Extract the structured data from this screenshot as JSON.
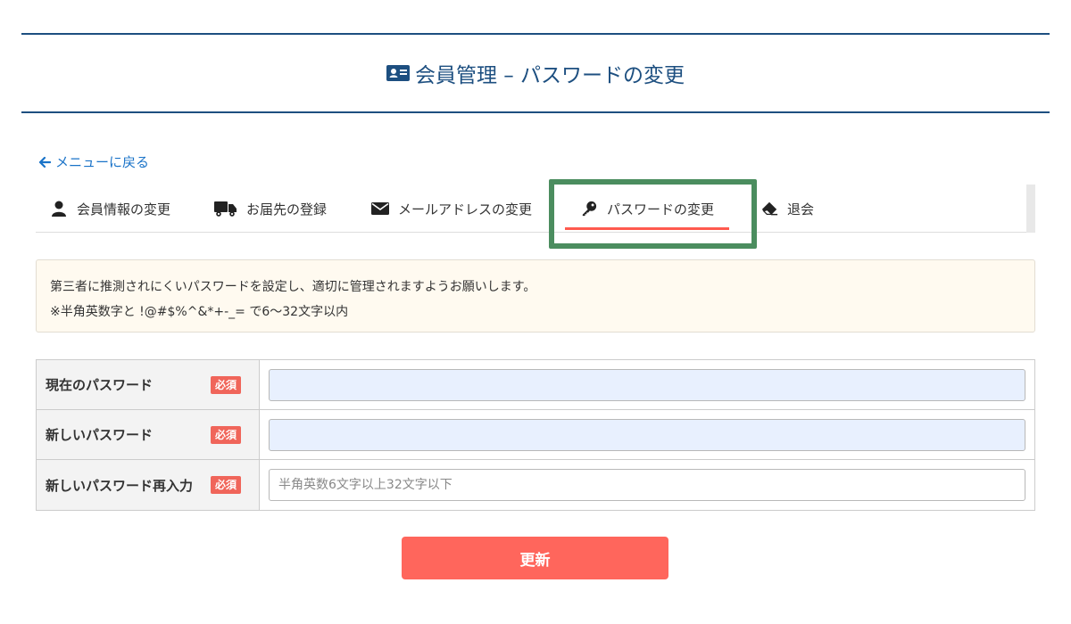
{
  "header": {
    "title": "会員管理 – パスワードの変更",
    "icon": "id-card-icon",
    "color": "#1d4f80"
  },
  "back_link": {
    "label": "メニューに戻る",
    "icon": "arrow-left-icon"
  },
  "tabs": [
    {
      "label": "会員情報の変更",
      "icon": "user-icon"
    },
    {
      "label": "お届先の登録",
      "icon": "truck-icon"
    },
    {
      "label": "メールアドレスの変更",
      "icon": "envelope-icon"
    },
    {
      "label": "パスワードの変更",
      "icon": "key-icon",
      "active": true
    },
    {
      "label": "退会",
      "icon": "eraser-icon"
    }
  ],
  "notice": {
    "line1": "第三者に推測されにくいパスワードを設定し、適切に管理されますようお願いします。",
    "line2": "※半角英数字と !@#$%^&*+-_= で6～32文字以内"
  },
  "form": {
    "required_label": "必須",
    "fields": [
      {
        "label": "現在のパスワード",
        "value": "",
        "placeholder": ""
      },
      {
        "label": "新しいパスワード",
        "value": "",
        "placeholder": ""
      },
      {
        "label": "新しいパスワード再入力",
        "value": "",
        "placeholder": "半角英数6文字以上32文字以下"
      }
    ]
  },
  "submit": {
    "label": "更新",
    "color": "#ff665c"
  },
  "colors": {
    "accent": "#ff5a4e",
    "highlight": "#4b8d5f",
    "link": "#1a73c8"
  }
}
